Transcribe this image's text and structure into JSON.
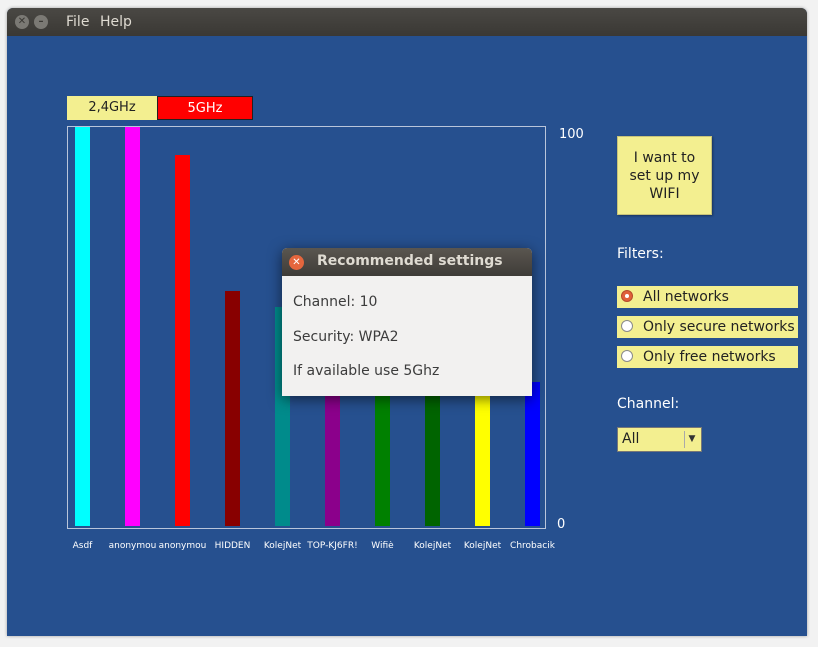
{
  "menu": {
    "file": "File",
    "help": "Help"
  },
  "band_tabs": {
    "band_24": "2,4GHz",
    "band_5": "5GHz"
  },
  "chart_data": {
    "type": "bar",
    "categories": [
      "Asdf",
      "anonymou",
      "anonymou",
      "HIDDEN",
      "KolejNet",
      "TOP-KJ6FR!",
      "Wifiè",
      "KolejNet",
      "KolejNet",
      "Chrobacik"
    ],
    "values": [
      100,
      100,
      93,
      59,
      55,
      50,
      45,
      43,
      42,
      36
    ],
    "colors": [
      "#00ffff",
      "#ff00ff",
      "#ff0000",
      "#880000",
      "#008b8b",
      "#8b008b",
      "#008000",
      "#006400",
      "#ffff00",
      "#0000ff"
    ],
    "ylim": [
      0,
      100
    ],
    "y_tick_max": "100",
    "y_tick_min": "0"
  },
  "setup_button": {
    "label": "I want to set up my WIFI"
  },
  "filters": {
    "label": "Filters:",
    "options": [
      {
        "label": "All networks",
        "selected": true
      },
      {
        "label": "Only secure networks",
        "selected": false
      },
      {
        "label": "Only free networks",
        "selected": false
      }
    ]
  },
  "channel": {
    "label": "Channel:",
    "value": "All"
  },
  "dialog": {
    "title": "Recommended settings",
    "channel_line": "Channel: 10",
    "security_line": "Security: WPA2",
    "band_line": "If available use 5Ghz"
  },
  "colors": {
    "background": "#26508f",
    "highlight": "#f3ef90",
    "band_5_tab": "#ff0000"
  }
}
